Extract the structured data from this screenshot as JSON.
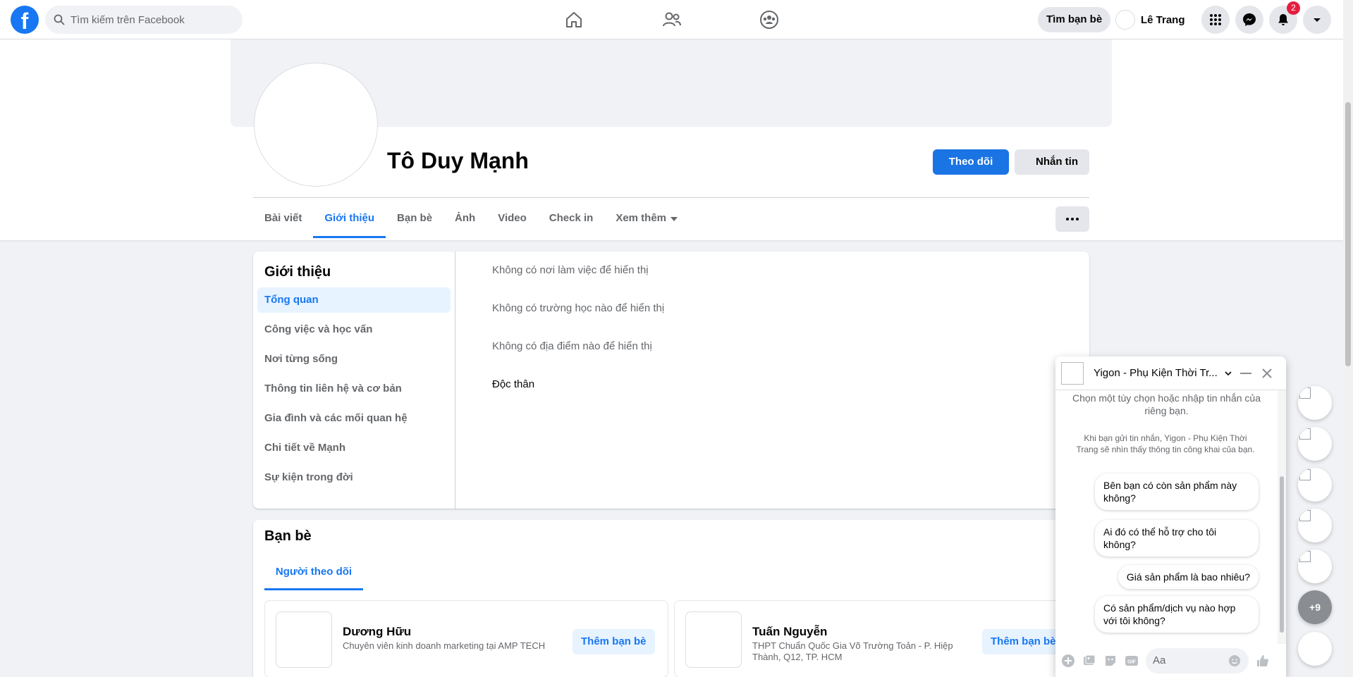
{
  "topbar": {
    "logo": "f",
    "search_placeholder": "Tìm kiếm trên Facebook",
    "nav_icons": [
      "home-icon",
      "friends-icon",
      "groups-icon"
    ],
    "find_friends_label": "Tìm bạn bè",
    "user_name": "Lê Trang",
    "notification_count": "2"
  },
  "profile": {
    "name": "Tô Duy Mạnh",
    "follow_label": "Theo dõi",
    "message_label": "Nhắn tin",
    "tabs": [
      {
        "label": "Bài viết"
      },
      {
        "label": "Giới thiệu",
        "active": true
      },
      {
        "label": "Bạn bè"
      },
      {
        "label": "Ảnh"
      },
      {
        "label": "Video"
      },
      {
        "label": "Check in"
      },
      {
        "label": "Xem thêm"
      }
    ]
  },
  "about": {
    "title": "Giới thiệu",
    "menu": [
      "Tổng quan",
      "Công việc và học vấn",
      "Nơi từng sống",
      "Thông tin liên hệ và cơ bản",
      "Gia đình và các mối quan hệ",
      "Chi tiết về Mạnh",
      "Sự kiện trong đời"
    ],
    "lines": [
      "Không có nơi làm việc để hiển thị",
      "Không có trường học nào để hiển thị",
      "Không có địa điểm nào để hiển thị",
      "Độc thân"
    ]
  },
  "friends": {
    "title": "Bạn bè",
    "tab": "Người theo dõi",
    "items": [
      {
        "name": "Dương Hữu",
        "desc": "Chuyên viên kinh doanh marketing tại AMP TECH",
        "button": "Thêm bạn bè"
      },
      {
        "name": "Tuấn Nguyễn",
        "desc": "THPT Chuẩn Quốc Gia Võ Trường Toản - P. Hiệp Thành, Q12, TP. HCM",
        "button": "Thêm bạn bè"
      }
    ]
  },
  "chat": {
    "title": "Yigon - Phụ Kiện Thời Tr...",
    "intro": "Chọn một tùy chọn hoặc nhập tin nhắn của riêng bạn.",
    "note": "Khi bạn gửi tin nhắn, Yigon - Phụ Kiện Thời Trang sẽ nhìn thấy thông tin công khai của bạn.",
    "quick_replies": [
      "Bên bạn có còn sản phẩm này không?",
      "Ai đó có thể hỗ trợ cho tôi không?",
      "Giá sản phẩm là bao nhiêu?",
      "Có sản phẩm/dịch vụ nào hợp với tôi không?"
    ],
    "input_placeholder": "Aa"
  },
  "bubbles": {
    "more_label": "+9"
  },
  "colors": {
    "brand": "#1877f2",
    "badge": "#e41e3f"
  }
}
